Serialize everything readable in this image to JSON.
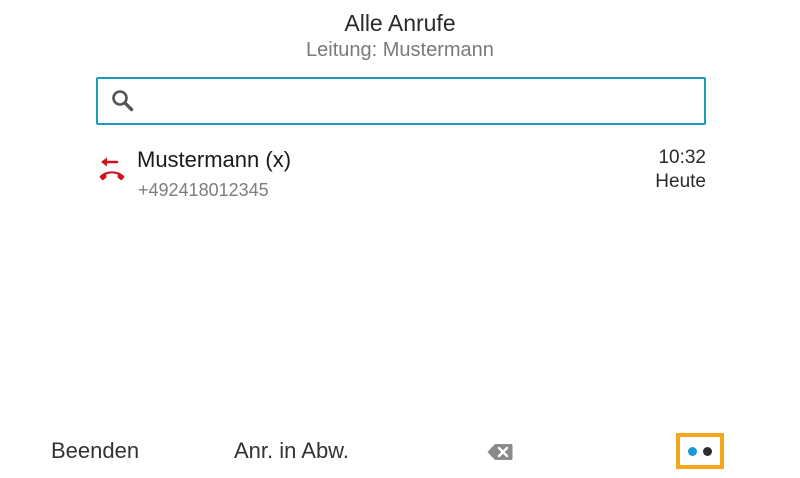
{
  "header": {
    "title": "Alle Anrufe",
    "subtitle": "Leitung: Mustermann"
  },
  "search": {
    "placeholder": "",
    "value": "",
    "icon": "search-icon"
  },
  "calls": [
    {
      "name": "Mustermann (x)",
      "number": "+492418012345",
      "time": "10:32",
      "date": "Heute",
      "type_icon": "missed-call-icon",
      "icon_color": "#d0101b"
    }
  ],
  "softkeys": {
    "end_label": "Beenden",
    "divert_label": "Anr. in Abw.",
    "backspace_icon": "backspace-icon",
    "more_icon": "more-icon"
  },
  "colors": {
    "accent": "#1a9bbd",
    "highlight": "#f4a71d",
    "missed": "#d0101b"
  }
}
